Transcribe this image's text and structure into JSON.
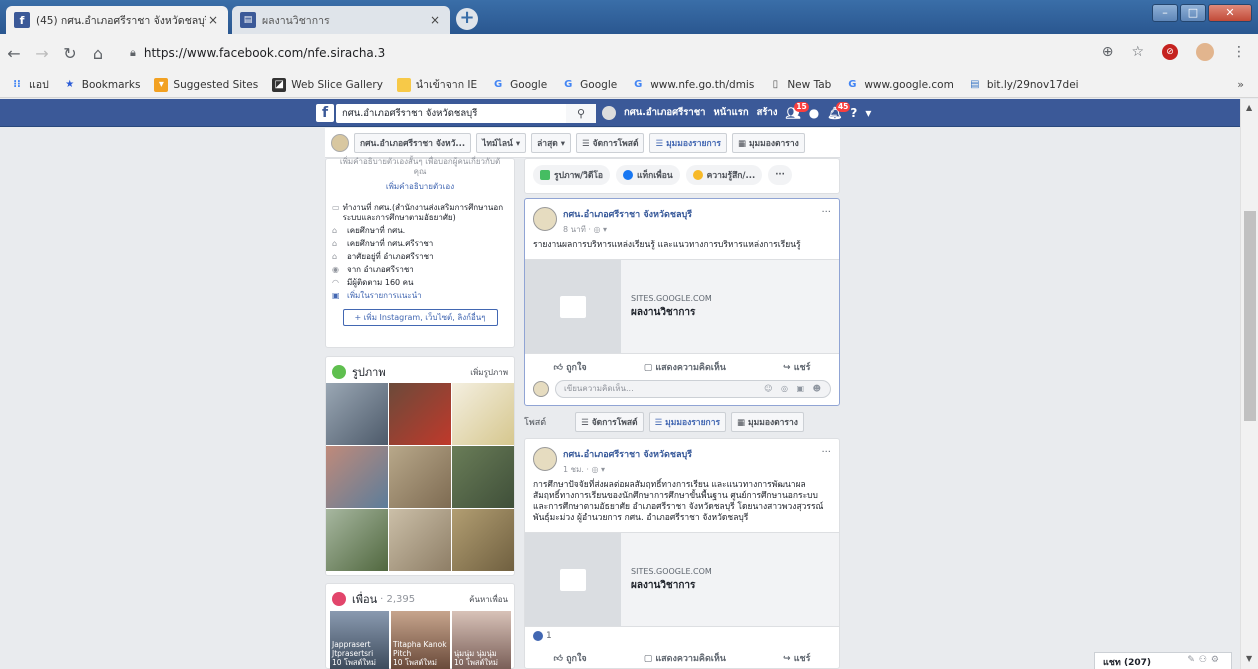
{
  "browser": {
    "tabs": [
      {
        "title": "(45) กศน.อำเภอศรีราชา จังหวัดชลบุรี",
        "close": "×"
      },
      {
        "title": "ผลงานวิชาการ",
        "close": "×"
      }
    ],
    "new_tab": "+",
    "url": "https://www.facebook.com/nfe.siracha.3",
    "bookmarks": [
      "แอป",
      "Bookmarks",
      "Suggested Sites",
      "Web Slice Gallery",
      "นำเข้าจาก IE",
      "Google",
      "Google",
      "www.nfe.go.th/dmis",
      "New Tab",
      "www.google.com",
      "bit.ly/29nov17dei"
    ],
    "bookmarks_more": "»"
  },
  "fb": {
    "search_value": "กศน.อำเภอศรีราชา จังหวัดชลบุรี",
    "nav": {
      "profile": "กศน.อำเภอศรีราชา",
      "home": "หน้าแรก",
      "create": "สร้าง",
      "badge_friends": "15",
      "badge_notif": "45"
    },
    "timeline_bar": {
      "name": "กศน.อำเภอศรีราชา จังหวั...",
      "timeline": "ไทม์ไลน์ ▾",
      "recent": "ล่าสุด ▾",
      "manage": "จัดการโพสต์",
      "list_view": "มุมมองรายการ",
      "grid_view": "มุมมองตาราง"
    },
    "intro": {
      "desc_line1": "เพิ่มคำอธิบายตัวเองสั้นๆ เพื่อบอกผู้คนเกี่ยวกับตั",
      "desc_line2": "คุณ",
      "add_bio": "เพิ่มคำอธิบายตัวเอง",
      "rows": [
        "ทำงานที่ กศน.(สำนักงานส่งเสริมการศึกษานอกระบบและการศึกษาตามอัธยาศัย)",
        "เคยศึกษาที่ กศน.",
        "เคยศึกษาที่ กศน.ศรีราชา",
        "อาศัยอยู่ที่ อำเภอศรีราชา",
        "จาก อำเภอศรีราชา",
        "มีผู้ติดตาม 160 คน"
      ],
      "featured": "เพิ่มในรายการแนะนำ",
      "add_links": "+ เพิ่ม Instagram, เว็บไซต์, ลิงก์อื่นๆ"
    },
    "photos": {
      "title": "รูปภาพ",
      "add": "เพิ่มรูปภาพ"
    },
    "friends": {
      "title": "เพื่อน",
      "count": "· 2,395",
      "find": "ค้นหาเพื่อน",
      "cards": [
        {
          "name": "Japprasert Jtprasertsri",
          "new": "10 โพสต์ใหม่"
        },
        {
          "name": "Titapha Kanok Pitch",
          "new": "10 โพสต์ใหม่"
        },
        {
          "name": "นุ่มนุ่ม นุ่มนุ่ม",
          "new": "10 โพสต์ใหม่"
        }
      ]
    },
    "composer": {
      "photo": "รูปภาพ/วิดีโอ",
      "tag": "แท็กเพื่อน",
      "feeling": "ความรู้สึก/...",
      "more": "···"
    },
    "post1": {
      "author": "กศน.อำเภอศรีราชา จังหวัดชลบุรี",
      "time": "8 นาที · ◎ ▾",
      "text": "รายงานผลการบริหารแหล่งเรียนรู้ และแนวทางการบริหารแหล่งการเรียนรู้",
      "link_domain": "SITES.GOOGLE.COM",
      "link_title": "ผลงานวิชาการ",
      "like": "ถูกใจ",
      "comment": "แสดงความคิดเห็น",
      "share": "แชร์",
      "comment_placeholder": "เขียนความคิดเห็น...",
      "comment_icons": "☺ ◎ ▣ ☻"
    },
    "viewbar": {
      "label": "โพสต์",
      "manage": "จัดการโพสต์",
      "list_view": "มุมมองรายการ",
      "grid_view": "มุมมองตาราง"
    },
    "post2": {
      "author": "กศน.อำเภอศรีราชา จังหวัดชลบุรี",
      "time": "1 ชม. · ◎ ▾",
      "text": "การศึกษาปัจจัยที่ส่งผลต่อผลสัมฤทธิ์ทางการเรียน และแนวทางการพัฒนาผลสัมฤทธิ์ทางการเรียนของนักศึกษาการศึกษาขั้นพื้นฐาน ศูนย์การศึกษานอกระบบและการศึกษาตามอัธยาศัย อำเภอศรีราชา จังหวัดชลบุรี โดยนางสาวพวงสุวรรณ์ พันธุ์มะม่วง ผู้อำนวยการ กศน. อำเภอศรีราชา จังหวัดชลบุรี",
      "link_domain": "SITES.GOOGLE.COM",
      "link_title": "ผลงานวิชาการ",
      "likes": "1",
      "like": "ถูกใจ",
      "comment": "แสดงความคิดเห็น",
      "share": "แชร์"
    },
    "chat": {
      "label": "แชท (207)"
    }
  }
}
